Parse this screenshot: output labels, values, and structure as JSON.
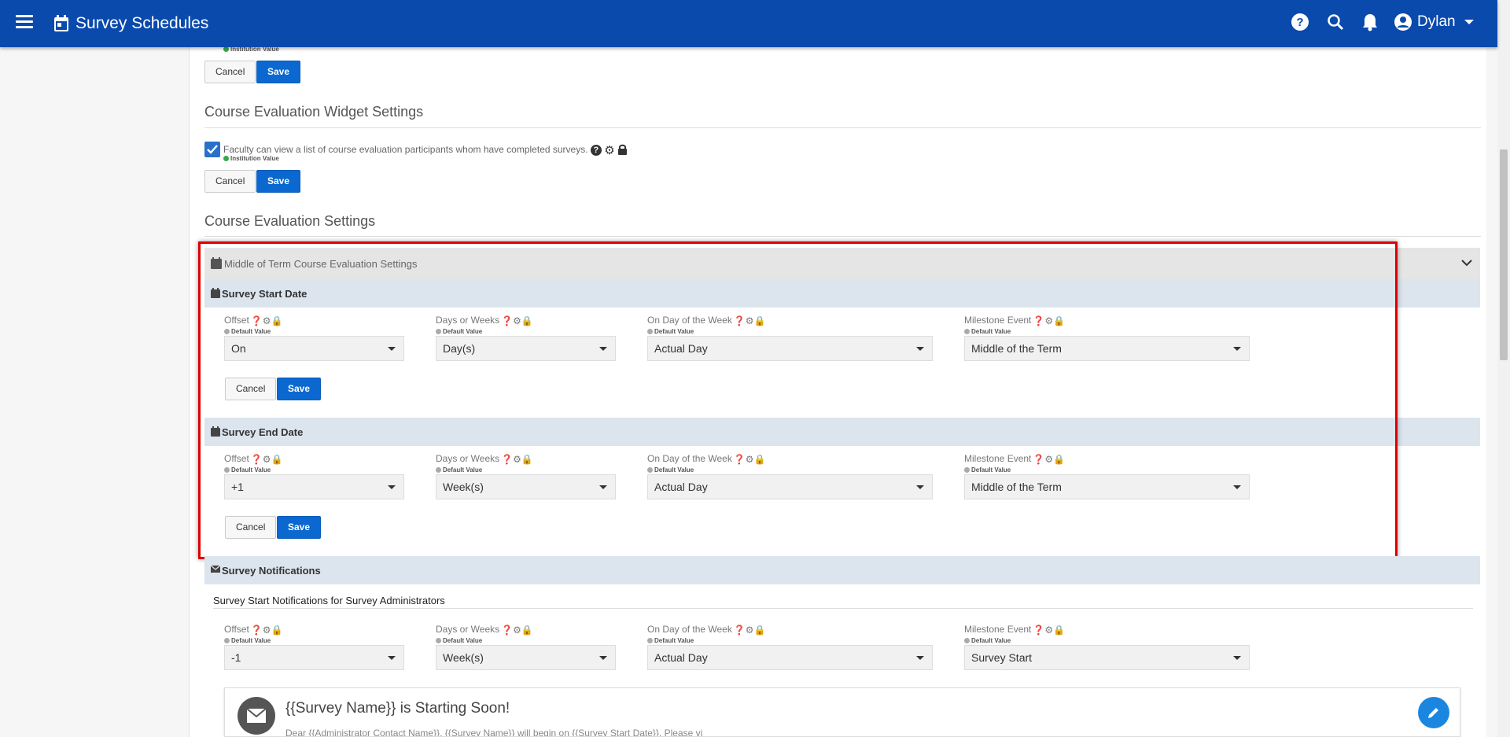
{
  "app": {
    "title": "Survey Schedules",
    "user": "Dylan",
    "icons": [
      "hamburger-menu-icon",
      "calendar-icon",
      "help-icon",
      "search-icon",
      "bell-icon",
      "account-circle-icon"
    ]
  },
  "top_partial": {
    "institution_value": "Institution Value",
    "cancel": "Cancel",
    "save": "Save"
  },
  "widget_settings": {
    "heading": "Course Evaluation Widget Settings",
    "checkbox_label": "Faculty can view a list of course evaluation participants whom have completed surveys.",
    "checked": true,
    "value_source": "Institution Value",
    "cancel": "Cancel",
    "save": "Save"
  },
  "course_eval_settings": {
    "heading": "Course Evaluation Settings",
    "accordion_title": "Middle of Term Course Evaluation Settings",
    "start": {
      "title": "Survey Start Date",
      "offset_label": "Offset",
      "offset_value": "On",
      "days_label": "Days or Weeks",
      "days_value": "Day(s)",
      "dow_label": "On Day of the Week",
      "dow_value": "Actual Day",
      "milestone_label": "Milestone Event",
      "milestone_value": "Middle of the Term",
      "default_value": "Default Value",
      "cancel": "Cancel",
      "save": "Save"
    },
    "end": {
      "title": "Survey End Date",
      "offset_label": "Offset",
      "offset_value": "+1",
      "days_label": "Days or Weeks",
      "days_value": "Week(s)",
      "dow_label": "On Day of the Week",
      "dow_value": "Actual Day",
      "milestone_label": "Milestone Event",
      "milestone_value": "Middle of the Term",
      "default_value": "Default Value",
      "cancel": "Cancel",
      "save": "Save"
    }
  },
  "notifications": {
    "title": "Survey Notifications",
    "sub_heading": "Survey Start Notifications for Survey Administrators",
    "offset_label": "Offset",
    "offset_value": "-1",
    "days_label": "Days or Weeks",
    "days_value": "Week(s)",
    "dow_label": "On Day of the Week",
    "dow_value": "Actual Day",
    "milestone_label": "Milestone Event",
    "milestone_value": "Survey Start",
    "default_value": "Default Value",
    "card_title": "{{Survey Name}} is Starting Soon!",
    "card_body": "Dear {{Administrator Contact Name}}, {{Survey Name}} will begin on {{Survey Start Date}}. Please vi"
  },
  "colors": {
    "appbar": "#0a4aad",
    "save_button": "#0a68d0",
    "highlight_border": "#dd0000",
    "checkbox": "#2a6fc9"
  }
}
